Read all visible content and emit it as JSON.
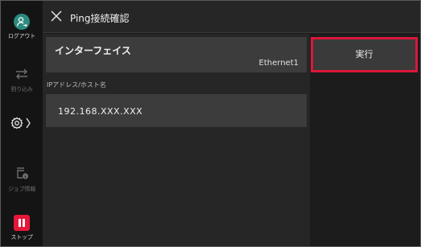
{
  "sidebar": {
    "logout_label": "ログアウト",
    "interrupt_label": "割り込み",
    "job_info_label": "ジョブ情報",
    "stop_label": "ストップ"
  },
  "header": {
    "title": "Ping接続確認"
  },
  "interface": {
    "label": "インターフェイス",
    "value": "Ethernet1"
  },
  "ip": {
    "label": "IPアドレス/ホスト名",
    "value": "192.168.XXX.XXX"
  },
  "actions": {
    "execute_label": "実行"
  },
  "colors": {
    "accent_red": "#d9173a",
    "logout_teal": "#2c8a7e"
  }
}
